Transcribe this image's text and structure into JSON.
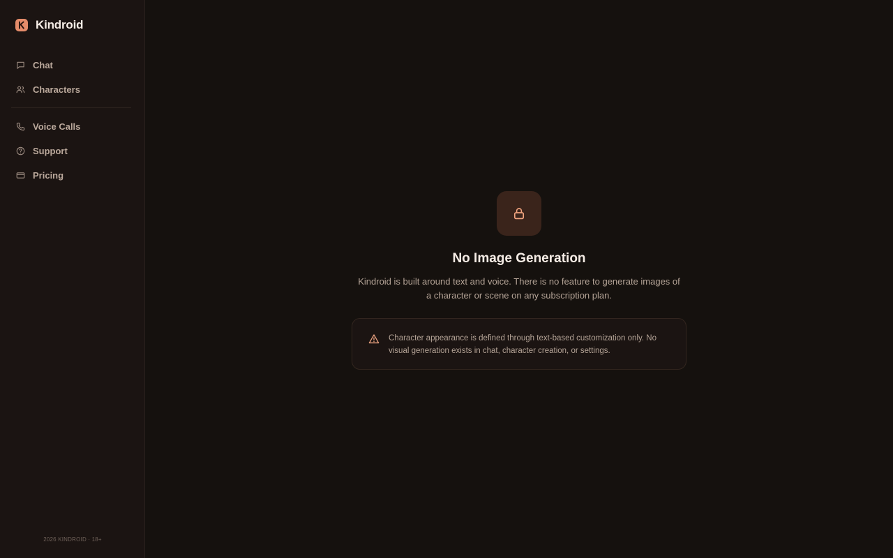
{
  "brand": {
    "name": "Kindroid",
    "logo_letter": "K"
  },
  "colors": {
    "accent": "#e58c6a",
    "sidebar_bg": "#1b1412",
    "main_bg": "#15110e",
    "tile_bg": "#3a241b"
  },
  "nav": {
    "primary": [
      {
        "label": "Chat",
        "icon": "chat-bubble-icon"
      },
      {
        "label": "Characters",
        "icon": "users-icon"
      }
    ],
    "secondary": [
      {
        "label": "Voice Calls",
        "icon": "phone-icon"
      },
      {
        "label": "Support",
        "icon": "help-circle-icon"
      },
      {
        "label": "Pricing",
        "icon": "credit-card-icon"
      }
    ]
  },
  "footer": {
    "text": "2026 KINDROID · 18+"
  },
  "main": {
    "icon": "lock-icon",
    "title": "No Image Generation",
    "description": "Kindroid is built around text and voice. There is no feature to generate images of a character or scene on any subscription plan.",
    "notice": {
      "icon": "warning-triangle-icon",
      "text": "Character appearance is defined through text-based customization only. No visual generation exists in chat, character creation, or settings."
    }
  }
}
